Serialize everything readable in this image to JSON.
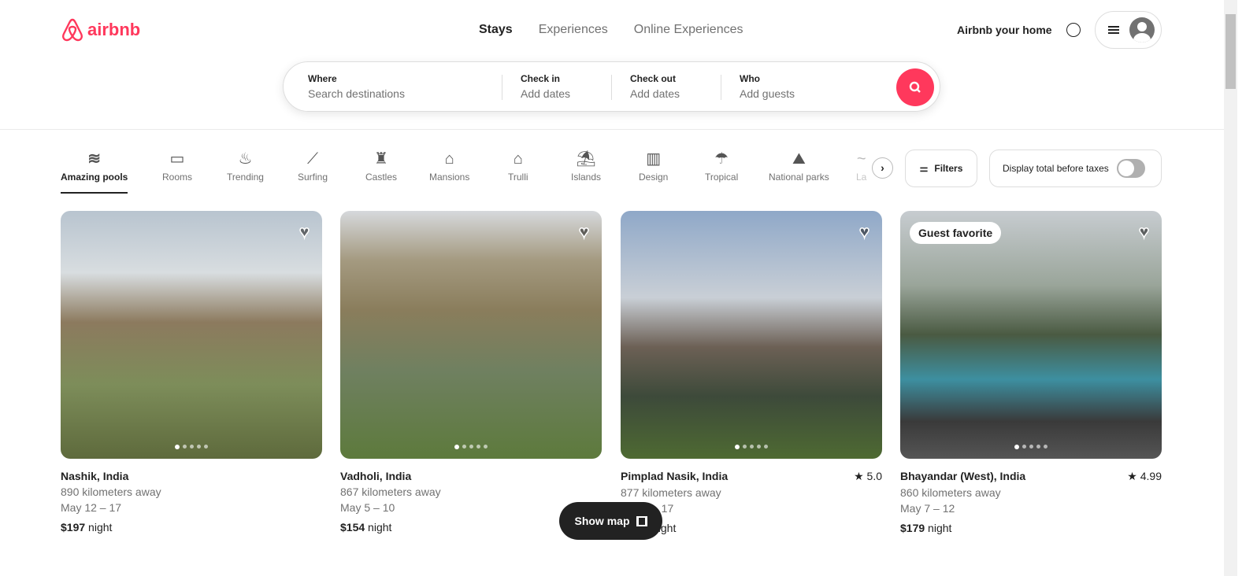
{
  "header": {
    "logo": "airbnb",
    "nav": [
      "Stays",
      "Experiences",
      "Online Experiences"
    ],
    "host": "Airbnb your home"
  },
  "search": {
    "where_label": "Where",
    "where_placeholder": "Search destinations",
    "checkin_label": "Check in",
    "checkin_value": "Add dates",
    "checkout_label": "Check out",
    "checkout_value": "Add dates",
    "who_label": "Who",
    "who_value": "Add guests"
  },
  "categories": [
    {
      "label": "Amazing pools",
      "icon": "pool-icon"
    },
    {
      "label": "Rooms",
      "icon": "bed-icon"
    },
    {
      "label": "Trending",
      "icon": "flame-icon"
    },
    {
      "label": "Surfing",
      "icon": "surfboard-icon"
    },
    {
      "label": "Castles",
      "icon": "castle-icon"
    },
    {
      "label": "Mansions",
      "icon": "mansion-icon"
    },
    {
      "label": "Trulli",
      "icon": "trullo-icon"
    },
    {
      "label": "Islands",
      "icon": "island-icon"
    },
    {
      "label": "Design",
      "icon": "design-icon"
    },
    {
      "label": "Tropical",
      "icon": "palm-icon"
    },
    {
      "label": "National parks",
      "icon": "park-icon"
    },
    {
      "label": "La",
      "icon": "lake-icon"
    }
  ],
  "filters": "Filters",
  "taxes": "Display total before taxes",
  "listings": [
    {
      "title": "Nashik, India",
      "rating": "",
      "distance": "890 kilometers away",
      "dates": "May 12 – 17",
      "price": "$197",
      "unit": "night",
      "badge": ""
    },
    {
      "title": "Vadholi, India",
      "rating": "",
      "distance": "867 kilometers away",
      "dates": "May 5 – 10",
      "price": "$154",
      "unit": "night",
      "badge": ""
    },
    {
      "title": "Pimplad Nasik, India",
      "rating": "5.0",
      "distance": "877 kilometers away",
      "dates": "– 17",
      "price": "",
      "unit": "night",
      "badge": ""
    },
    {
      "title": "Bhayandar (West), India",
      "rating": "4.99",
      "distance": "860 kilometers away",
      "dates": "May 7 – 12",
      "price": "$179",
      "unit": "night",
      "badge": "Guest favorite"
    }
  ],
  "show_map": "Show map",
  "colors": {
    "brand": "#ff385c"
  }
}
